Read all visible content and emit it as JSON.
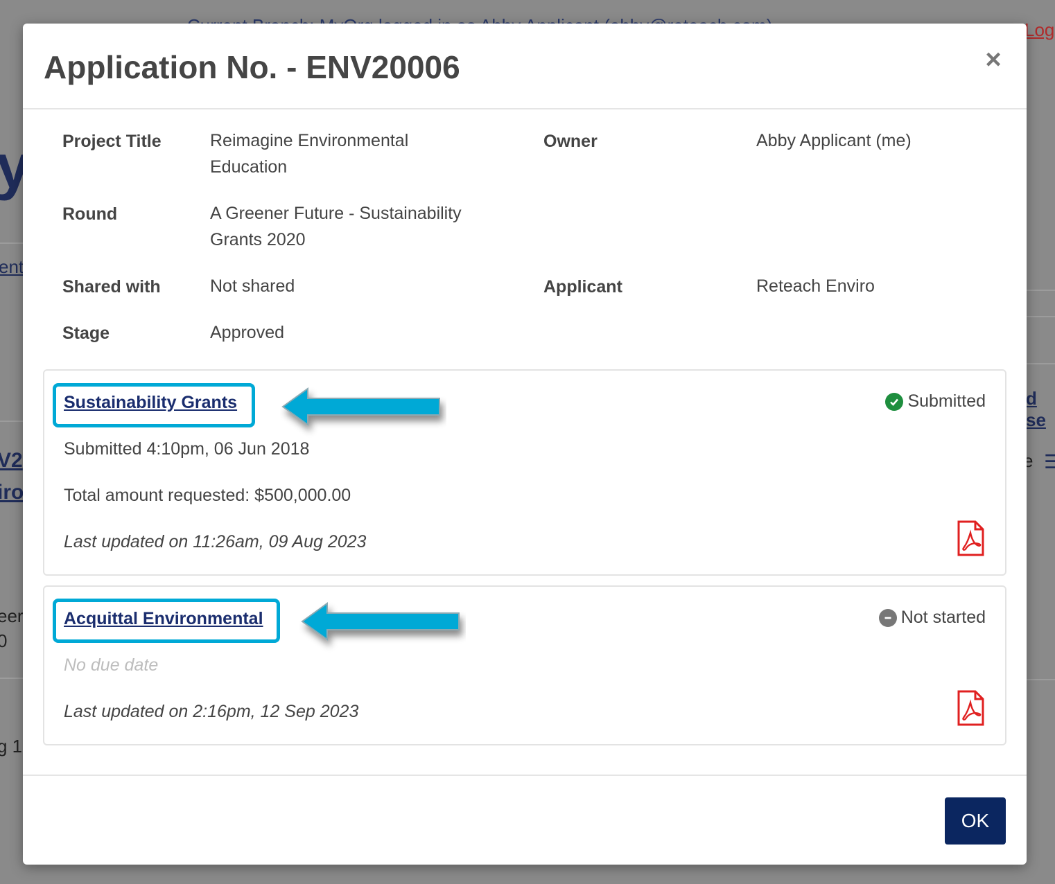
{
  "background": {
    "top_text": "Current Branch: MyOrg logged in as Abby Applicant (abby@reteach.com)",
    "logout": "Log",
    "y": "y",
    "ent": "ent",
    "v2": "V2",
    "iro": "iro",
    "eer": "eer",
    "zero": "0",
    "g1": "g 1",
    "dse": "d se",
    "e": "e",
    "menu": "☰"
  },
  "modal": {
    "title": "Application No. - ENV20006",
    "close_label": "×",
    "fields": {
      "project_title_label": "Project Title",
      "project_title_line1": "Reimagine Environmental",
      "project_title_line2": "Education",
      "owner_label": "Owner",
      "owner_value": "Abby Applicant (me)",
      "round_label": "Round",
      "round_line1": "A Greener Future - Sustainability",
      "round_line2": "Grants 2020",
      "shared_label": "Shared with",
      "shared_value": "Not shared",
      "applicant_label": "Applicant",
      "applicant_value": "Reteach Enviro",
      "stage_label": "Stage",
      "stage_value": "Approved"
    },
    "forms": [
      {
        "name": "Sustainability Grants",
        "status": "Submitted",
        "submitted": "Submitted 4:10pm, 06 Jun 2018",
        "amount": "Total amount requested: $500,000.00",
        "updated": "Last updated on 11:26am, 09 Aug 2023"
      },
      {
        "name": "Acquittal Environmental",
        "status": "Not started",
        "due": "No due date",
        "updated": "Last updated on 2:16pm, 12 Sep 2023"
      }
    ],
    "ok_label": "OK"
  },
  "colors": {
    "accent_highlight": "#00a9d6",
    "link": "#1a2d6e",
    "primary_button": "#0b2660",
    "submitted_green": "#1e8e3e",
    "not_started_grey": "#777777",
    "pdf_red": "#e02020"
  },
  "icons": [
    "close-icon",
    "check-circle-icon",
    "minus-circle-icon",
    "pdf-icon",
    "arrow-left-icon"
  ]
}
